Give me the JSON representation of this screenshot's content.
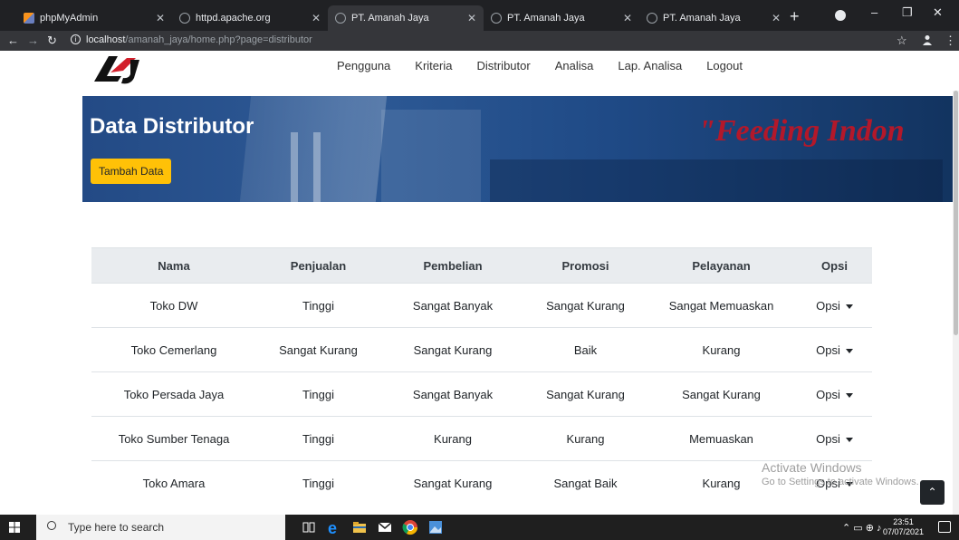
{
  "browser": {
    "tabs": [
      {
        "label": "phpMyAdmin",
        "icon": "phpmyadmin-icon"
      },
      {
        "label": "httpd.apache.org",
        "icon": "globe-icon"
      },
      {
        "label": "PT. Amanah Jaya",
        "icon": "globe-icon",
        "active": true
      },
      {
        "label": "PT. Amanah Jaya",
        "icon": "globe-icon"
      },
      {
        "label": "PT. Amanah Jaya",
        "icon": "globe-icon"
      }
    ],
    "url_host": "localhost",
    "url_path": "/amanah_jaya/home.php?page=distributor"
  },
  "nav": {
    "items": [
      "Pengguna",
      "Kriteria",
      "Distributor",
      "Analisa",
      "Lap. Analisa",
      "Logout"
    ]
  },
  "hero": {
    "title": "Data Distributor",
    "slogan": "\"Feeding Indon",
    "add_button": "Tambah Data"
  },
  "table": {
    "headers": [
      "Nama",
      "Penjualan",
      "Pembelian",
      "Promosi",
      "Pelayanan",
      "Opsi"
    ],
    "rows": [
      [
        "Toko DW",
        "Tinggi",
        "Sangat Banyak",
        "Sangat Kurang",
        "Sangat Memuaskan",
        "Opsi"
      ],
      [
        "Toko Cemerlang",
        "Sangat Kurang",
        "Sangat Kurang",
        "Baik",
        "Kurang",
        "Opsi"
      ],
      [
        "Toko Persada Jaya",
        "Tinggi",
        "Sangat Banyak",
        "Sangat Kurang",
        "Sangat Kurang",
        "Opsi"
      ],
      [
        "Toko Sumber Tenaga",
        "Tinggi",
        "Kurang",
        "Kurang",
        "Memuaskan",
        "Opsi"
      ],
      [
        "Toko Amara",
        "Tinggi",
        "Sangat Kurang",
        "Sangat Baik",
        "Kurang",
        "Opsi"
      ]
    ]
  },
  "watermark": {
    "line1": "Activate Windows",
    "line2": "Go to Settings to activate Windows."
  },
  "taskbar": {
    "search_placeholder": "Type here to search",
    "time": "23:51",
    "date": "07/07/2021"
  },
  "colors": {
    "accent_button": "#ffc107",
    "hero_bg": "#234a85",
    "slogan": "#b3182a"
  }
}
